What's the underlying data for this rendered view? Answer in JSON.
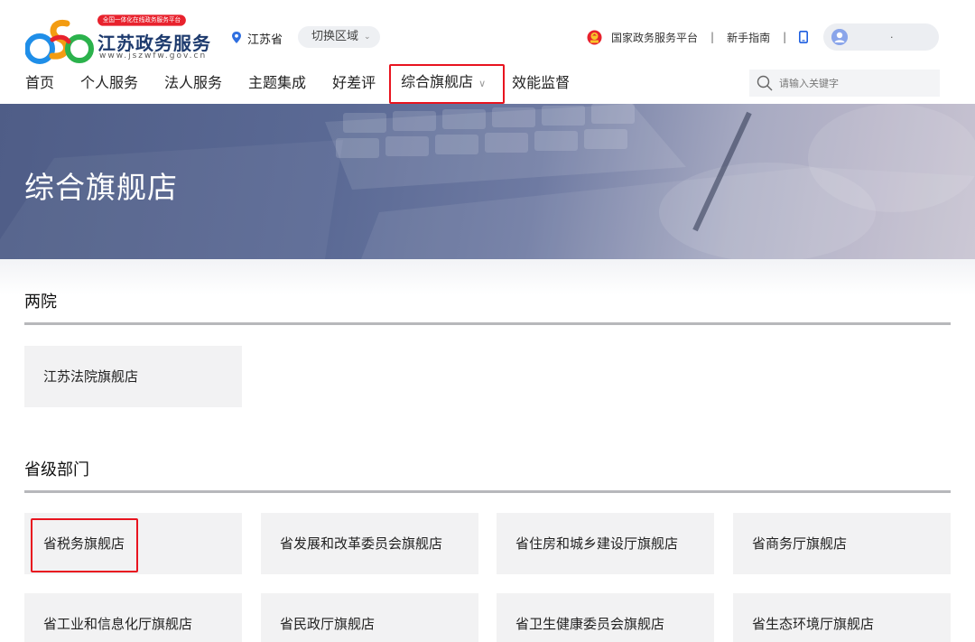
{
  "header": {
    "logo": {
      "badge": "全国一体化在线政务服务平台",
      "name": "江苏政务服务",
      "url": "www.jszwfw.gov.cn"
    },
    "location": {
      "province": "江苏省",
      "switch_label": "切换区域"
    },
    "links": {
      "national_platform": "国家政务服务平台",
      "sep": "|",
      "guide": "新手指南"
    },
    "user": {
      "name": "."
    },
    "nav": [
      {
        "label": "首页"
      },
      {
        "label": "个人服务"
      },
      {
        "label": "法人服务"
      },
      {
        "label": "主题集成"
      },
      {
        "label": "好差评"
      },
      {
        "label": "综合旗舰店"
      },
      {
        "label": "效能监督"
      }
    ],
    "search": {
      "placeholder": "请输入关键字"
    }
  },
  "banner": {
    "title": "综合旗舰店"
  },
  "sections": [
    {
      "title": "两院",
      "cards": [
        "江苏法院旗舰店"
      ]
    },
    {
      "title": "省级部门",
      "cards": [
        "省税务旗舰店",
        "省发展和改革委员会旗舰店",
        "省住房和城乡建设厅旗舰店",
        "省商务厅旗舰店",
        "省工业和信息化厅旗舰店",
        "省民政厅旗舰店",
        "省卫生健康委员会旗舰店",
        "省生态环境厅旗舰店"
      ]
    }
  ],
  "colors": {
    "highlight_box": "#e8141f",
    "logo_text": "#1d3a6d",
    "badge": "#e8222d",
    "banner": "#56648f",
    "card_bg": "#f2f2f3"
  },
  "icons": [
    "pin-icon",
    "chevron-down-icon",
    "national-emblem-icon",
    "phone-icon",
    "user-avatar-icon",
    "search-icon"
  ]
}
